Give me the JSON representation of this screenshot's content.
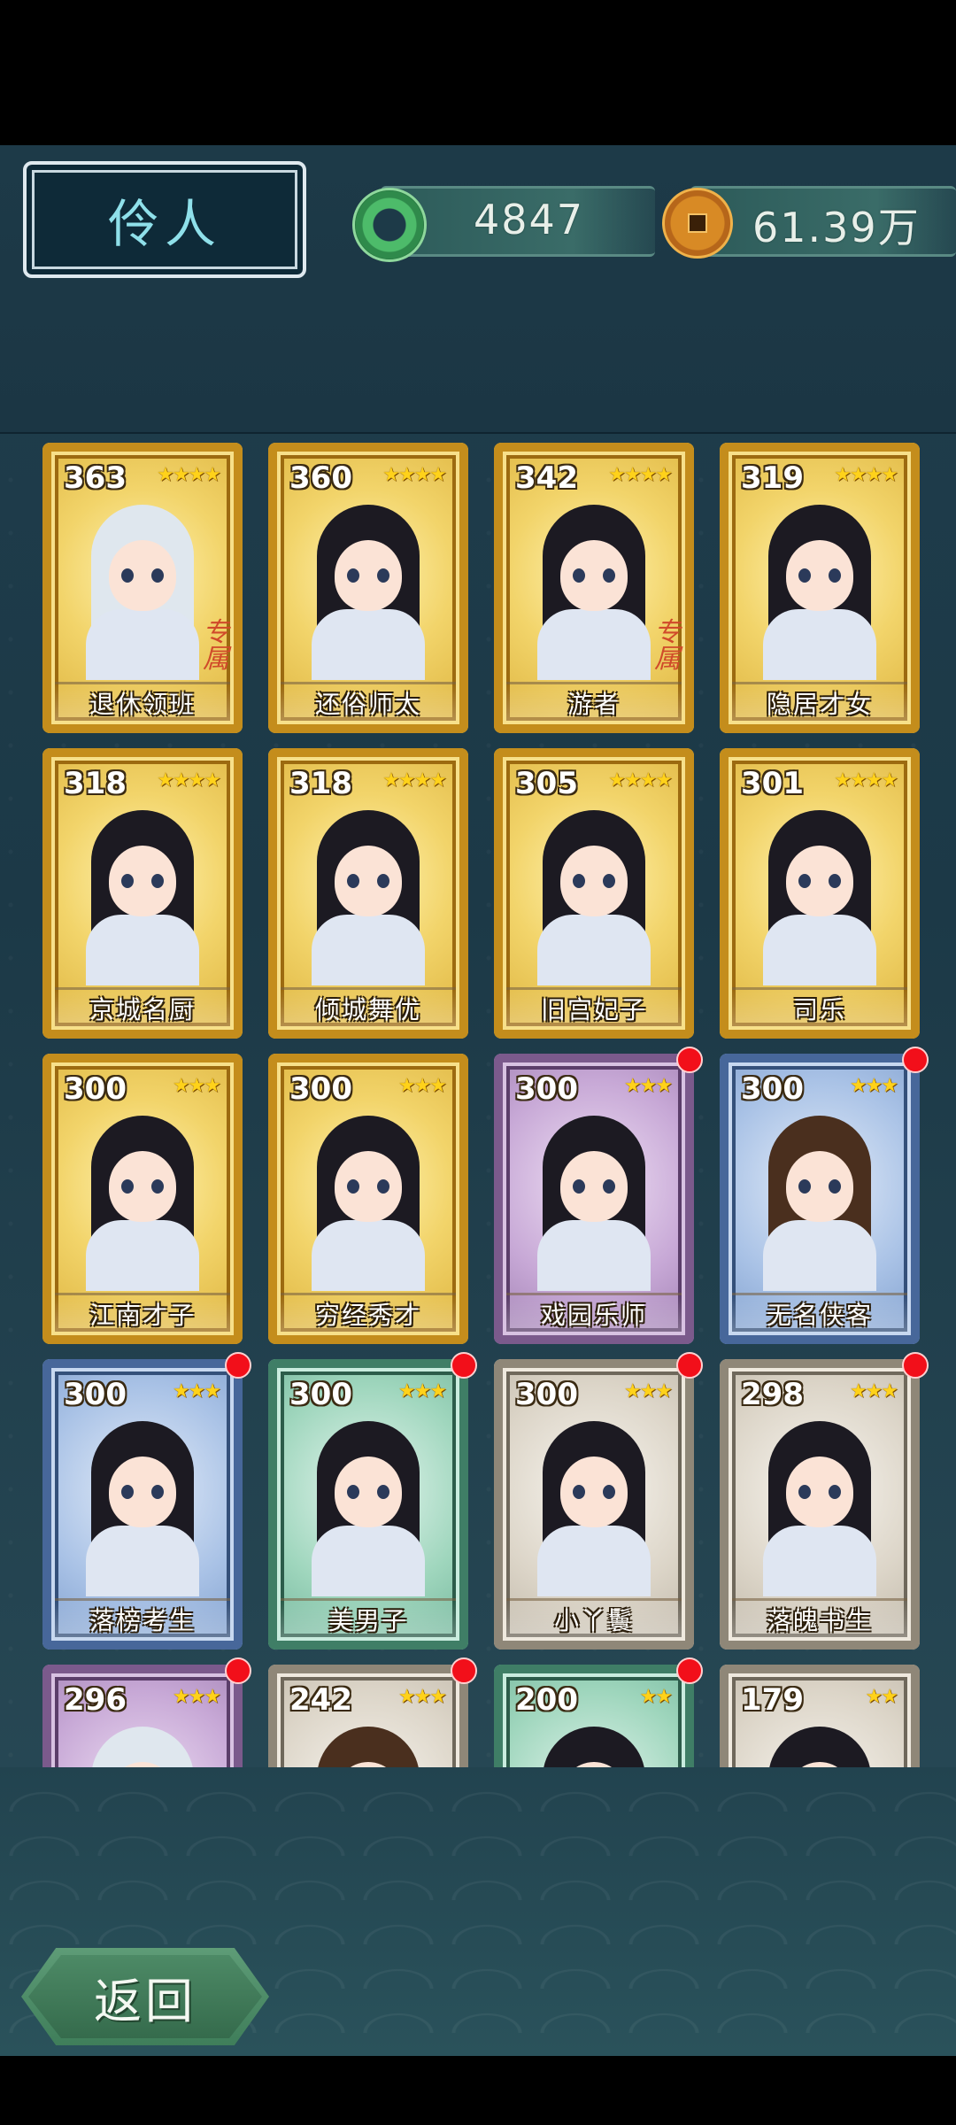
{
  "header": {
    "title": "伶人",
    "jade_amount": "4847",
    "coin_amount": "61.39万"
  },
  "cards": [
    {
      "level": "363",
      "stars": "★★★★",
      "name": "退休领班",
      "rarity": "gold",
      "hair": "white",
      "exclusive": "专属"
    },
    {
      "level": "360",
      "stars": "★★★★",
      "name": "还俗师太",
      "rarity": "gold",
      "hair": "dark"
    },
    {
      "level": "342",
      "stars": "★★★★",
      "name": "游者",
      "rarity": "gold",
      "hair": "dark",
      "exclusive": "专属"
    },
    {
      "level": "319",
      "stars": "★★★★",
      "name": "隐居才女",
      "rarity": "gold",
      "hair": "dark"
    },
    {
      "level": "318",
      "stars": "★★★★",
      "name": "京城名厨",
      "rarity": "gold",
      "hair": "dark"
    },
    {
      "level": "318",
      "stars": "★★★★",
      "name": "倾城舞优",
      "rarity": "gold",
      "hair": "dark"
    },
    {
      "level": "305",
      "stars": "★★★★",
      "name": "旧宫妃子",
      "rarity": "gold",
      "hair": "dark"
    },
    {
      "level": "301",
      "stars": "★★★★",
      "name": "司乐",
      "rarity": "gold",
      "hair": "dark"
    },
    {
      "level": "300",
      "stars": "★★★",
      "name": "江南才子",
      "rarity": "gold",
      "hair": "dark"
    },
    {
      "level": "300",
      "stars": "★★★",
      "name": "穷经秀才",
      "rarity": "gold",
      "hair": "dark"
    },
    {
      "level": "300",
      "stars": "★★★",
      "name": "戏园乐师",
      "rarity": "purple",
      "hair": "dark",
      "badge": true
    },
    {
      "level": "300",
      "stars": "★★★",
      "name": "无名侠客",
      "rarity": "blue",
      "hair": "brown",
      "badge": true
    },
    {
      "level": "300",
      "stars": "★★★",
      "name": "落榜考生",
      "rarity": "blue",
      "hair": "dark",
      "badge": true
    },
    {
      "level": "300",
      "stars": "★★★",
      "name": "美男子",
      "rarity": "green",
      "hair": "dark",
      "badge": true
    },
    {
      "level": "300",
      "stars": "★★★",
      "name": "小丫鬟",
      "rarity": "gray",
      "hair": "dark",
      "badge": true
    },
    {
      "level": "298",
      "stars": "★★★",
      "name": "落魄书生",
      "rarity": "gray",
      "hair": "dark",
      "badge": true
    },
    {
      "level": "296",
      "stars": "★★★",
      "name": "",
      "rarity": "purple",
      "hair": "white",
      "badge": true
    },
    {
      "level": "242",
      "stars": "★★★",
      "name": "",
      "rarity": "gray",
      "hair": "brown",
      "badge": true
    },
    {
      "level": "200",
      "stars": "★★",
      "name": "",
      "rarity": "green",
      "hair": "dark",
      "badge": true
    },
    {
      "level": "179",
      "stars": "★★",
      "name": "",
      "rarity": "gray",
      "hair": "dark"
    }
  ],
  "footer": {
    "back_label": "返回"
  },
  "colors": {
    "background": "#1f3d4c",
    "title_text": "#8fe0ea",
    "badge_red": "#f20f1a",
    "star_yellow": "#ffd21a"
  }
}
